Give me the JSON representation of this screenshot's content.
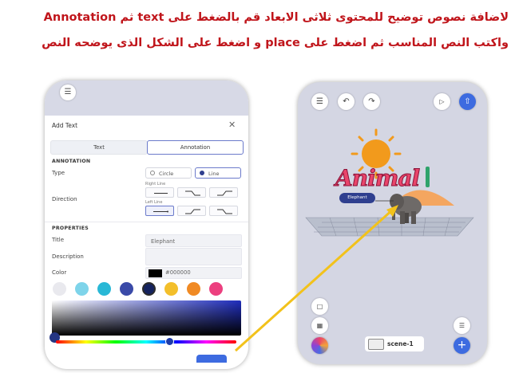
{
  "instructions": {
    "line1": "لاضافة نصوص توضيح للمحتوى ثلاثى الابعاد قم بالضغط على  text ثم Annotation",
    "line2": "واكتب النص المناسب ثم اضغط على place و اضغط على الشكل الذى يوضحه النص"
  },
  "left_panel": {
    "title": "Add Text",
    "tabs": [
      "Text",
      "Annotation"
    ],
    "active_tab": "Annotation",
    "annotation_heading": "ANNOTATION",
    "type_label": "Type",
    "type_options": [
      "Circle",
      "Line"
    ],
    "type_selected": "Line",
    "direction_label": "Direction",
    "right_line_label": "Right Line",
    "left_line_label": "Left Line",
    "properties_heading": "PROPERTIES",
    "title_label": "Title",
    "title_value": "Elephant",
    "description_label": "Description",
    "color_label": "Color",
    "color_value": "#000000",
    "swatches": [
      "#e9e9ee",
      "#7ed4ea",
      "#29b8d6",
      "#3a4aa8",
      "#15235e",
      "#f3bf2b",
      "#f08a24",
      "#ec3f7f"
    ],
    "selected_swatch_index": 3,
    "hue_position": 0.63
  },
  "right_panel": {
    "scene_label": "scene-1",
    "text_3d": "Animal",
    "annotation_tag": "Elephant"
  },
  "colors": {
    "accent": "#3d6be0",
    "instruction_text": "#c0151b",
    "arrow": "#f2c21b"
  }
}
